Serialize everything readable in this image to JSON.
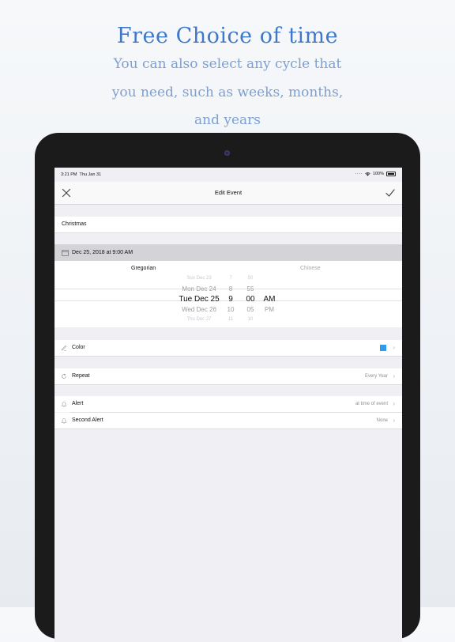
{
  "promo": {
    "title": "Free Choice of time",
    "subtitle_lines": [
      "You can also select any cycle that",
      "you need, such as weeks, months,",
      "and years"
    ]
  },
  "status_bar": {
    "time": "3:21 PM",
    "date": "Thu Jan 31",
    "battery": "100%"
  },
  "nav": {
    "title": "Edit Event",
    "close_icon": "close-icon",
    "confirm_icon": "checkmark-icon"
  },
  "event": {
    "name": "Christmas",
    "date_summary": "Dec 25, 2018 at 9:00 AM"
  },
  "calendar_tabs": {
    "selected": "Gregorian",
    "other": "Chinese"
  },
  "picker": {
    "days": [
      "Sun Dec 23",
      "Mon Dec 24",
      "Tue Dec 25",
      "Wed Dec 26",
      "Thu Dec 27"
    ],
    "hours": [
      "7",
      "8",
      "9",
      "10",
      "11"
    ],
    "minutes": [
      "50",
      "55",
      "00",
      "05",
      "10"
    ],
    "ampm": [
      "AM",
      "PM"
    ]
  },
  "rows": {
    "color": {
      "label": "Color",
      "value_color": "#2d9cf0"
    },
    "repeat": {
      "label": "Repeat",
      "value": "Every Year"
    },
    "alert": {
      "label": "Alert",
      "value": "at time of event"
    },
    "second_alert": {
      "label": "Second Alert",
      "value": "None"
    }
  },
  "colors": {
    "accent": "#3f78c8",
    "selected_color": "#2d9cf0"
  }
}
